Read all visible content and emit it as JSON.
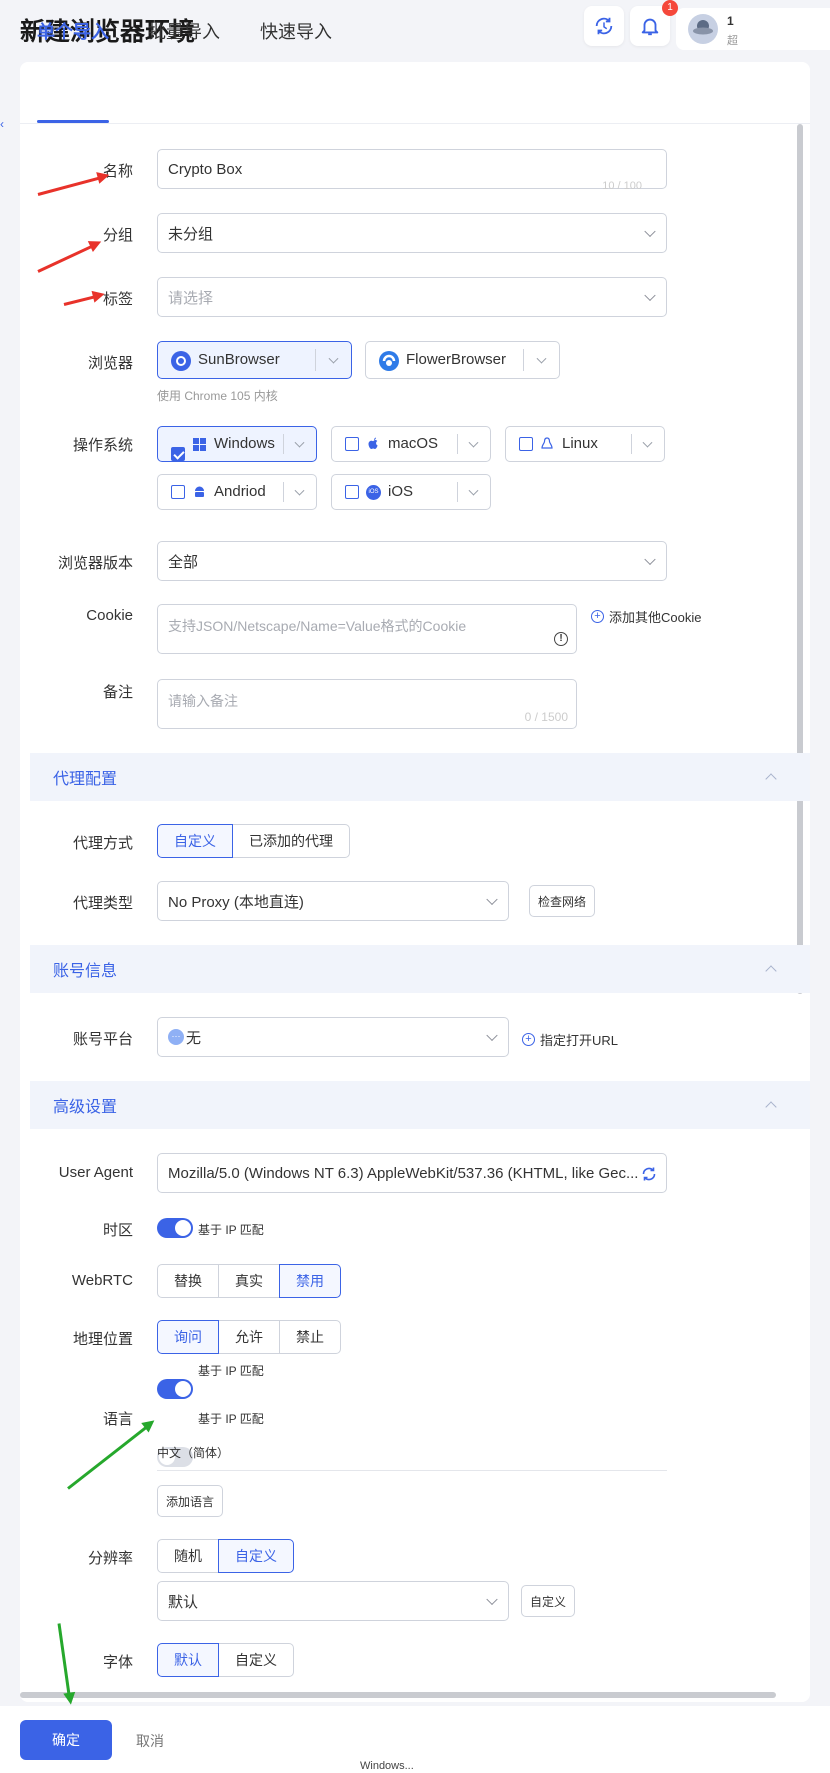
{
  "header": {
    "title": "新建浏览器环境",
    "notification_count": "1",
    "user_partial_line1": "1",
    "user_partial_line2": "超"
  },
  "tabs": [
    "单个导入",
    "批量导入",
    "快速导入"
  ],
  "form": {
    "name": {
      "label": "名称",
      "value": "Crypto Box",
      "counter": "10 / 100"
    },
    "group": {
      "label": "分组",
      "value": "未分组"
    },
    "tags": {
      "label": "标签",
      "placeholder": "请选择"
    },
    "browser": {
      "label": "浏览器",
      "options": [
        "SunBrowser",
        "FlowerBrowser"
      ],
      "selected": "SunBrowser",
      "hint": "使用 Chrome 105 内核"
    },
    "os": {
      "label": "操作系统",
      "options": [
        "Windows",
        "macOS",
        "Linux",
        "Andriod",
        "iOS"
      ],
      "selected": "Windows"
    },
    "browser_version": {
      "label": "浏览器版本",
      "value": "全部"
    },
    "cookie": {
      "label": "Cookie",
      "placeholder": "支持JSON/Netscape/Name=Value格式的Cookie",
      "add_link": "添加其他Cookie"
    },
    "remark": {
      "label": "备注",
      "placeholder": "请输入备注",
      "counter": "0 / 1500"
    }
  },
  "proxy": {
    "section_title": "代理配置",
    "method_label": "代理方式",
    "method_options": [
      "自定义",
      "已添加的代理"
    ],
    "method_selected": "自定义",
    "type_label": "代理类型",
    "type_value": "No Proxy (本地直连)",
    "check_button": "检查网络"
  },
  "account": {
    "section_title": "账号信息",
    "platform_label": "账号平台",
    "platform_value": "无",
    "url_link": "指定打开URL"
  },
  "advanced": {
    "section_title": "高级设置",
    "ua_label": "User Agent",
    "ua_value": "Mozilla/5.0 (Windows NT 6.3) AppleWebKit/537.36 (KHTML, like Gec...",
    "timezone_label": "时区",
    "timezone_toggle": "基于 IP 匹配",
    "webrtc_label": "WebRTC",
    "webrtc_options": [
      "替换",
      "真实",
      "禁用"
    ],
    "webrtc_selected": "禁用",
    "geo_label": "地理位置",
    "geo_options": [
      "询问",
      "允许",
      "禁止"
    ],
    "geo_selected": "询问",
    "geo_toggle": "基于 IP 匹配",
    "lang_label": "语言",
    "lang_toggle": "基于 IP 匹配",
    "lang_value": "中文（简体）",
    "add_lang_button": "添加语言",
    "resolution_label": "分辨率",
    "resolution_options": [
      "随机",
      "自定义"
    ],
    "resolution_selected": "自定义",
    "resolution_value": "默认",
    "resolution_custom_button": "自定义",
    "font_label": "字体",
    "font_options": [
      "默认",
      "自定义"
    ],
    "font_selected": "默认"
  },
  "footer": {
    "confirm": "确定",
    "cancel": "取消",
    "taskbar_text": "Windows..."
  },
  "colors": {
    "accent": "#3b63e6",
    "section_bg": "#f1f4fb",
    "annotation_red": "#e8322a",
    "annotation_green": "#26a82c"
  }
}
